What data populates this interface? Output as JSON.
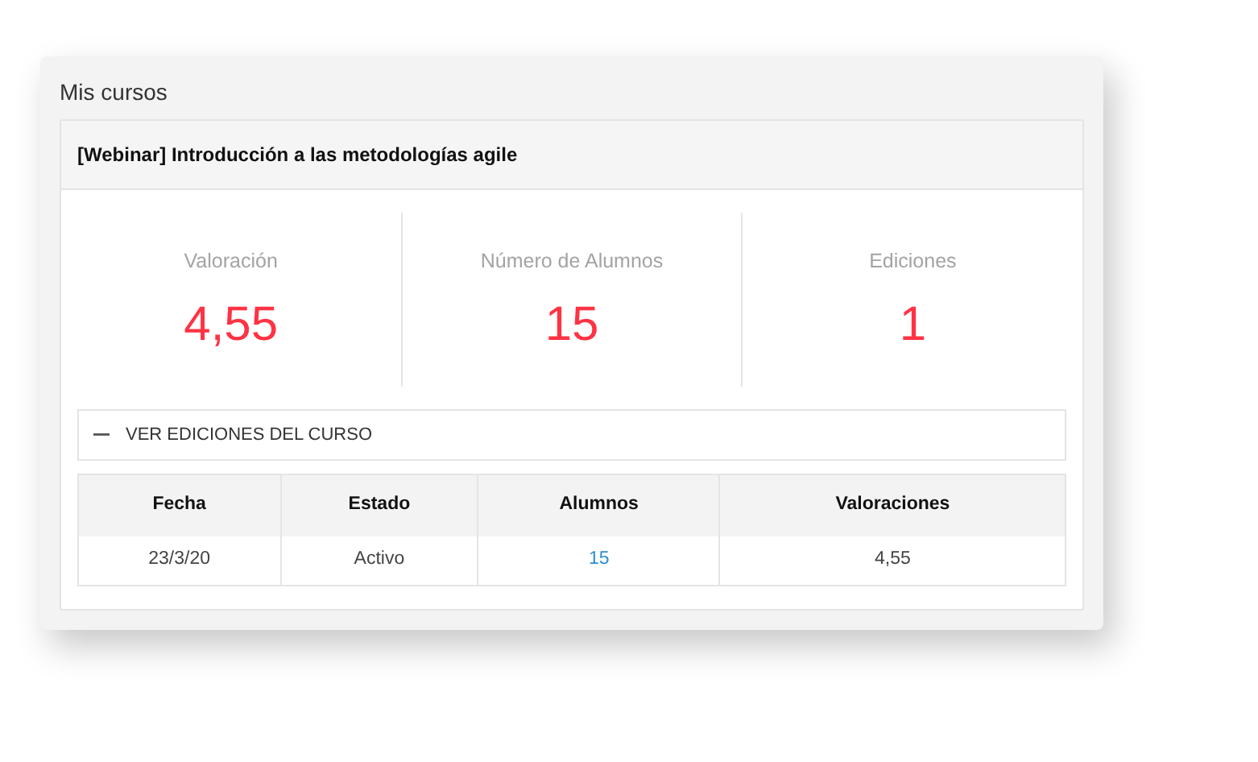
{
  "section_title": "Mis cursos",
  "course": {
    "title": "[Webinar] Introducción a las metodologías agile",
    "stats": [
      {
        "label": "Valoración",
        "value": "4,55"
      },
      {
        "label": "Número de Alumnos",
        "value": "15"
      },
      {
        "label": "Ediciones",
        "value": "1"
      }
    ],
    "editions_toggle": {
      "label": "VER EDICIONES DEL CURSO",
      "expanded": true
    },
    "table": {
      "columns": [
        "Fecha",
        "Estado",
        "Alumnos",
        "Valoraciones"
      ],
      "rows": [
        [
          {
            "kind": "text",
            "text": "23/3/20"
          },
          {
            "kind": "text",
            "text": "Activo"
          },
          {
            "kind": "link",
            "text": "15"
          },
          {
            "kind": "text",
            "text": "4,55"
          }
        ]
      ]
    }
  }
}
